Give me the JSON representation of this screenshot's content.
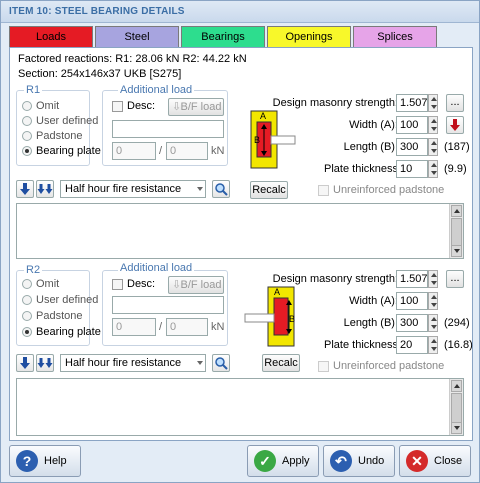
{
  "title": "ITEM 10: STEEL BEARING DETAILS",
  "tabs": [
    {
      "label": "Loads",
      "color": "#e51b24"
    },
    {
      "label": "Steel",
      "color": "#a7a4df"
    },
    {
      "label": "Bearings",
      "color": "#2ddd8e"
    },
    {
      "label": "Openings",
      "color": "#f8f82a"
    },
    {
      "label": "Splices",
      "color": "#e6a4e8"
    }
  ],
  "info": {
    "reactions": "Factored reactions:  R1: 28.06 kN   R2: 44.22 kN",
    "section": "Section: 254x146x37 UKB [S275]"
  },
  "r1": {
    "group_title": "R1",
    "options": [
      "Omit",
      "User defined",
      "Padstone",
      "Bearing plate"
    ],
    "selected": 3,
    "additional_load_title": "Additional load",
    "desc_label": "Desc:",
    "bf_load_label": "B/F load",
    "desc_value": "",
    "load1": "0",
    "slash": "/",
    "load2": "0",
    "unit": "kN",
    "design_masonry_strength_label": "Design masonry strength:",
    "design_masonry_strength": "1.507",
    "width_label": "Width (A):",
    "width": "100",
    "length_label": "Length (B):",
    "length": "300",
    "length_hint": "(187)",
    "plate_thickness_label": "Plate thickness",
    "plate_thickness": "10",
    "plate_thickness_hint": "(9.9)",
    "unreinforced_label": "Unreinforced padstone",
    "fire_resistance": "Half hour fire resistance",
    "recalc_label": "Recalc",
    "dots_label": "..."
  },
  "r2": {
    "group_title": "R2",
    "options": [
      "Omit",
      "User defined",
      "Padstone",
      "Bearing plate"
    ],
    "selected": 3,
    "additional_load_title": "Additional load",
    "desc_label": "Desc:",
    "bf_load_label": "B/F load",
    "desc_value": "",
    "load1": "0",
    "slash": "/",
    "load2": "0",
    "unit": "kN",
    "design_masonry_strength_label": "Design masonry strength:",
    "design_masonry_strength": "1.507",
    "width_label": "Width (A):",
    "width": "100",
    "length_label": "Length (B):",
    "length": "300",
    "length_hint": "(294)",
    "plate_thickness_label": "Plate thickness",
    "plate_thickness": "20",
    "plate_thickness_hint": "(16.8)",
    "unreinforced_label": "Unreinforced padstone",
    "fire_resistance": "Half hour fire resistance",
    "recalc_label": "Recalc",
    "dots_label": "..."
  },
  "diagram": {
    "label_a": "A",
    "label_b": "B"
  },
  "buttons": {
    "help": "Help",
    "apply": "Apply",
    "undo": "Undo",
    "close": "Close"
  },
  "colors": {
    "accent": "#3b6ea5",
    "bearing_yellow": "#f2e600",
    "bearing_red": "#e51b24"
  }
}
